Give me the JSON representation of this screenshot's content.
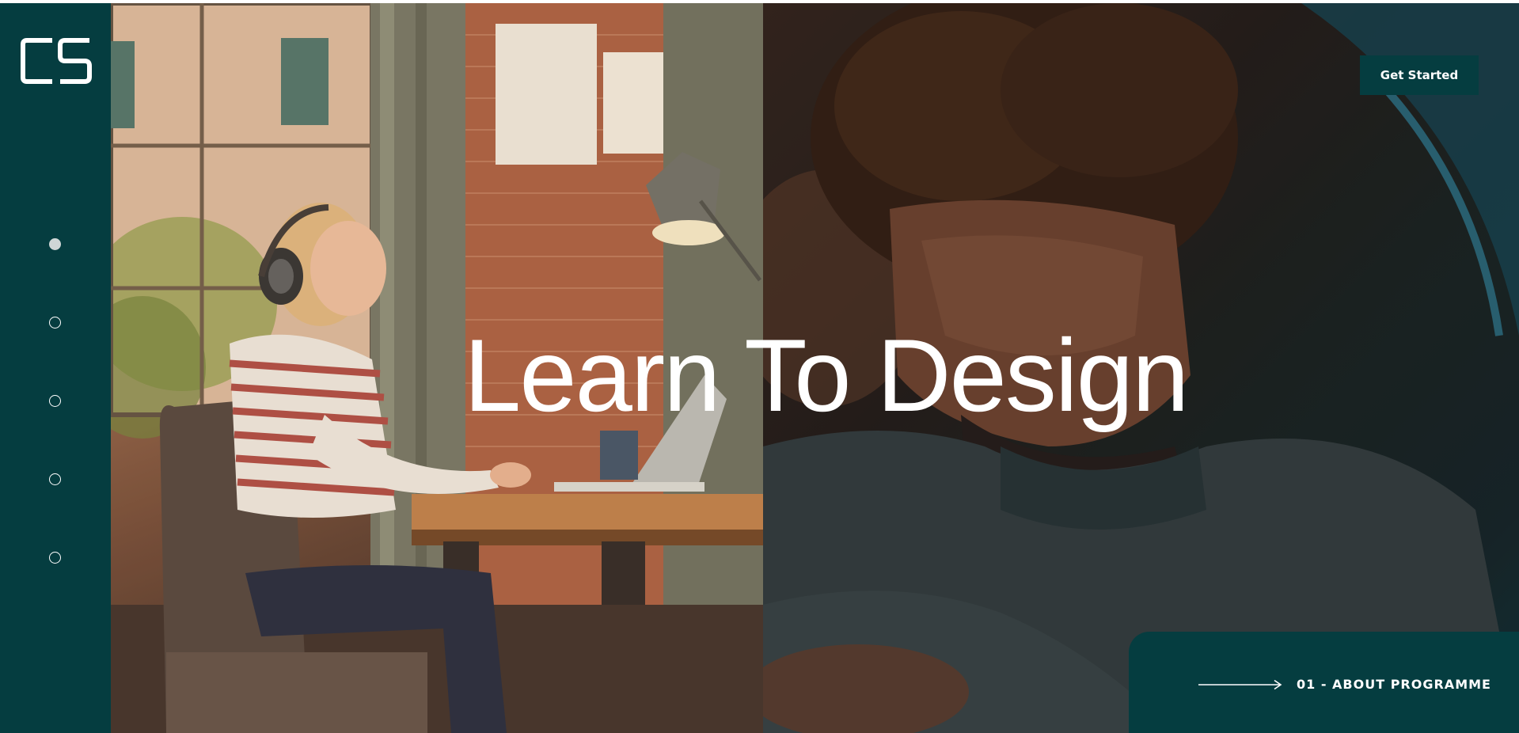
{
  "brand": {
    "logo_text": "CS",
    "primary_color": "#053d40"
  },
  "sidebar": {
    "slides": [
      {
        "active": true
      },
      {
        "active": false
      },
      {
        "active": false
      },
      {
        "active": false
      },
      {
        "active": false
      }
    ]
  },
  "hero": {
    "title": "Learn To Design",
    "cta_label": "Get Started",
    "menu_icon": "grid-icon"
  },
  "about": {
    "label": "01 - ABOUT PROGRAMME",
    "arrow_icon": "long-arrow-right-icon"
  }
}
